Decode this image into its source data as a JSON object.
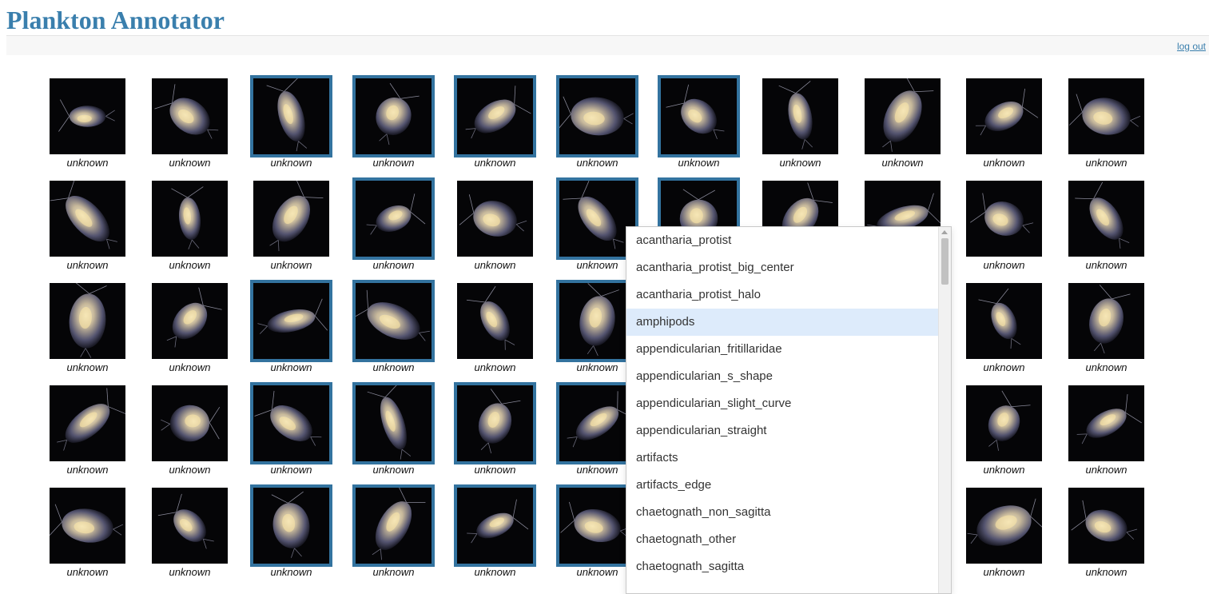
{
  "app": {
    "title": "Plankton Annotator",
    "logout_label": "log out"
  },
  "grid": {
    "rows": [
      {
        "tiles": [
          {
            "label": "unknown",
            "selected": false
          },
          {
            "label": "unknown",
            "selected": false
          },
          {
            "label": "unknown",
            "selected": true
          },
          {
            "label": "unknown",
            "selected": true
          },
          {
            "label": "unknown",
            "selected": true
          },
          {
            "label": "unknown",
            "selected": true
          },
          {
            "label": "unknown",
            "selected": true
          },
          {
            "label": "unknown",
            "selected": false
          },
          {
            "label": "unknown",
            "selected": false
          },
          {
            "label": "unknown",
            "selected": false
          },
          {
            "label": "unknown",
            "selected": false
          }
        ]
      },
      {
        "tiles": [
          {
            "label": "unknown",
            "selected": false
          },
          {
            "label": "unknown",
            "selected": false
          },
          {
            "label": "unknown",
            "selected": false
          },
          {
            "label": "unknown",
            "selected": true
          },
          {
            "label": "unknown",
            "selected": false
          },
          {
            "label": "unknown",
            "selected": true
          },
          {
            "label": "",
            "selected": true
          },
          {
            "label": "",
            "selected": false
          },
          {
            "label": "",
            "selected": false
          },
          {
            "label": "unknown",
            "selected": false
          },
          {
            "label": "unknown",
            "selected": false
          }
        ]
      },
      {
        "tiles": [
          {
            "label": "unknown",
            "selected": false
          },
          {
            "label": "unknown",
            "selected": false
          },
          {
            "label": "unknown",
            "selected": true
          },
          {
            "label": "unknown",
            "selected": true
          },
          {
            "label": "unknown",
            "selected": false
          },
          {
            "label": "unknown",
            "selected": true
          },
          {
            "label": "",
            "selected": false
          },
          {
            "label": "",
            "selected": false
          },
          {
            "label": "",
            "selected": false
          },
          {
            "label": "unknown",
            "selected": false
          },
          {
            "label": "unknown",
            "selected": false
          }
        ]
      },
      {
        "tiles": [
          {
            "label": "unknown",
            "selected": false
          },
          {
            "label": "unknown",
            "selected": false
          },
          {
            "label": "unknown",
            "selected": true
          },
          {
            "label": "unknown",
            "selected": true
          },
          {
            "label": "unknown",
            "selected": true
          },
          {
            "label": "unknown",
            "selected": true
          },
          {
            "label": "",
            "selected": false
          },
          {
            "label": "",
            "selected": false
          },
          {
            "label": "",
            "selected": false
          },
          {
            "label": "unknown",
            "selected": false
          },
          {
            "label": "unknown",
            "selected": false
          }
        ]
      },
      {
        "tiles": [
          {
            "label": "unknown",
            "selected": false
          },
          {
            "label": "unknown",
            "selected": false
          },
          {
            "label": "unknown",
            "selected": true
          },
          {
            "label": "unknown",
            "selected": true
          },
          {
            "label": "unknown",
            "selected": true
          },
          {
            "label": "unknown",
            "selected": true
          },
          {
            "label": "",
            "selected": false
          },
          {
            "label": "",
            "selected": false
          },
          {
            "label": "",
            "selected": false
          },
          {
            "label": "unknown",
            "selected": false
          },
          {
            "label": "unknown",
            "selected": false
          }
        ]
      }
    ]
  },
  "dropdown": {
    "highlighted": "amphipods",
    "options": [
      "acantharia_protist",
      "acantharia_protist_big_center",
      "acantharia_protist_halo",
      "amphipods",
      "appendicularian_fritillaridae",
      "appendicularian_s_shape",
      "appendicularian_slight_curve",
      "appendicularian_straight",
      "artifacts",
      "artifacts_edge",
      "chaetognath_non_sagitta",
      "chaetognath_other",
      "chaetognath_sagitta"
    ]
  },
  "colors": {
    "title": "#3a7fad",
    "selection_border": "#33739f",
    "highlight": "#ddebfb",
    "thumbnail_background": "#050507"
  }
}
